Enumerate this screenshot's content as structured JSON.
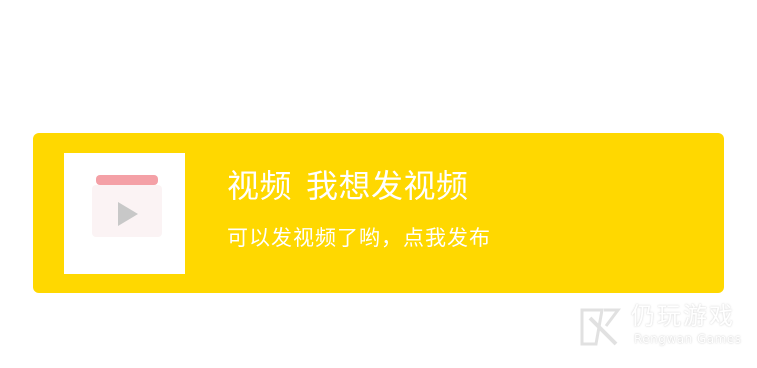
{
  "card": {
    "title_main": "视频",
    "title_sub": "我想发视频",
    "subtitle": "可以发视频了哟，点我发布",
    "background_color": "#FFD800",
    "thumbnail_icon": "video-play-icon",
    "thumbnail_tab_color": "#F4A0A6",
    "thumbnail_play_color": "#C8C8C8"
  },
  "watermark": {
    "name_cn": "仍玩游戏",
    "name_en": "Rengwan Games",
    "logo_icon": "rengwan-logo-icon"
  }
}
